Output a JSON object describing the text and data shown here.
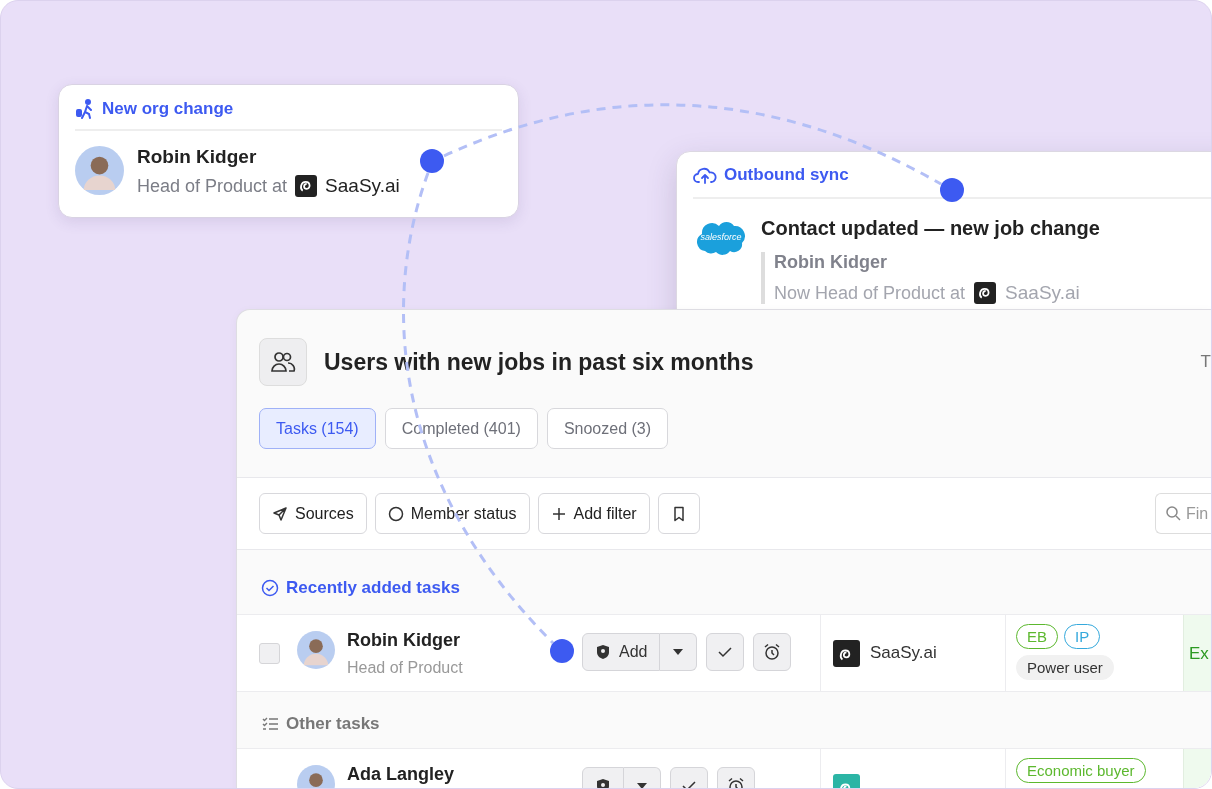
{
  "org_change_card": {
    "title": "New org change",
    "person": {
      "name": "Robin Kidger",
      "role": "Head of Product at",
      "company": "SaaSy.ai"
    }
  },
  "sync_card": {
    "title": "Outbound sync",
    "logo_text": "salesforce",
    "headline": "Contact updated — new job change",
    "person": {
      "name": "Robin Kidger",
      "role": "Now Head of Product at",
      "company": "SaaSy.ai"
    }
  },
  "panel": {
    "title": "Users with new jobs in past six months",
    "title_right": "T",
    "tabs": [
      {
        "label": "Tasks (154)",
        "selected": true
      },
      {
        "label": "Completed (401)",
        "selected": false
      },
      {
        "label": "Snoozed (3)",
        "selected": false
      }
    ],
    "filters": [
      {
        "label": "Sources",
        "kind": "sources"
      },
      {
        "label": "Member status",
        "kind": "status"
      },
      {
        "label": "Add filter",
        "kind": "add"
      }
    ],
    "search": {
      "placeholder": "Fin"
    },
    "sections": [
      {
        "title": "Recently added tasks",
        "kind": "recent",
        "rows": [
          {
            "name": "Robin Kidger",
            "role": "Head of Product",
            "checked": false,
            "add_label": "Add",
            "company": {
              "name": "SaaSy.ai",
              "color": "#222222"
            },
            "tags": [
              {
                "label": "EB",
                "kind": "outline",
                "color": "#5cb82e"
              },
              {
                "label": "IP",
                "kind": "outline",
                "color": "#35a9dc"
              },
              {
                "label": "Power user",
                "kind": "filled",
                "color": "#f1f1f1"
              }
            ],
            "status": "Ex"
          }
        ]
      },
      {
        "title": "Other tasks",
        "kind": "other",
        "rows": [
          {
            "name": "Ada Langley",
            "company": {
              "color": "#2bb5a5"
            },
            "tags": [
              {
                "label": "Economic buyer",
                "kind": "outline",
                "color": "#5cb82e"
              }
            ]
          }
        ]
      }
    ]
  }
}
